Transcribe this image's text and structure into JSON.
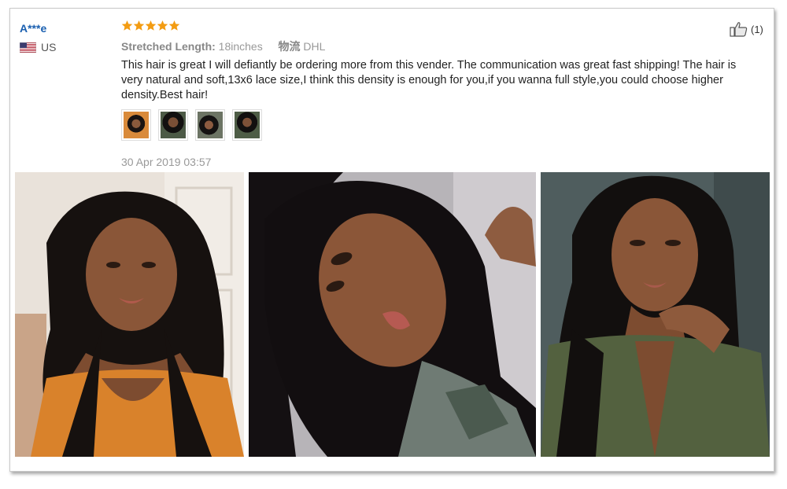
{
  "reviewer": {
    "name": "A***e",
    "country_code": "US",
    "flag_icon": "us-flag-icon"
  },
  "rating": {
    "stars": 5,
    "max": 5,
    "color": "#f39c12"
  },
  "attributes": {
    "length_label": "Stretched Length:",
    "length_value": "18inches",
    "shipping_label": "物流",
    "shipping_value": "DHL"
  },
  "review_text": "This hair is great I will defiantly be ordering more from this vender. The communication was great fast shipping! The hair is very natural and soft,13x6 lace size,I think this density is enough for you,if you wanna full style,you could choose higher density.Best hair!",
  "thumbnail_count": 4,
  "date": "30 Apr 2019 03:57",
  "helpful": {
    "icon": "thumbs-up-icon",
    "count": "(1)"
  },
  "colors": {
    "username": "#1a5fb0",
    "star": "#f39c12",
    "text": "#222222",
    "muted": "#999999"
  }
}
